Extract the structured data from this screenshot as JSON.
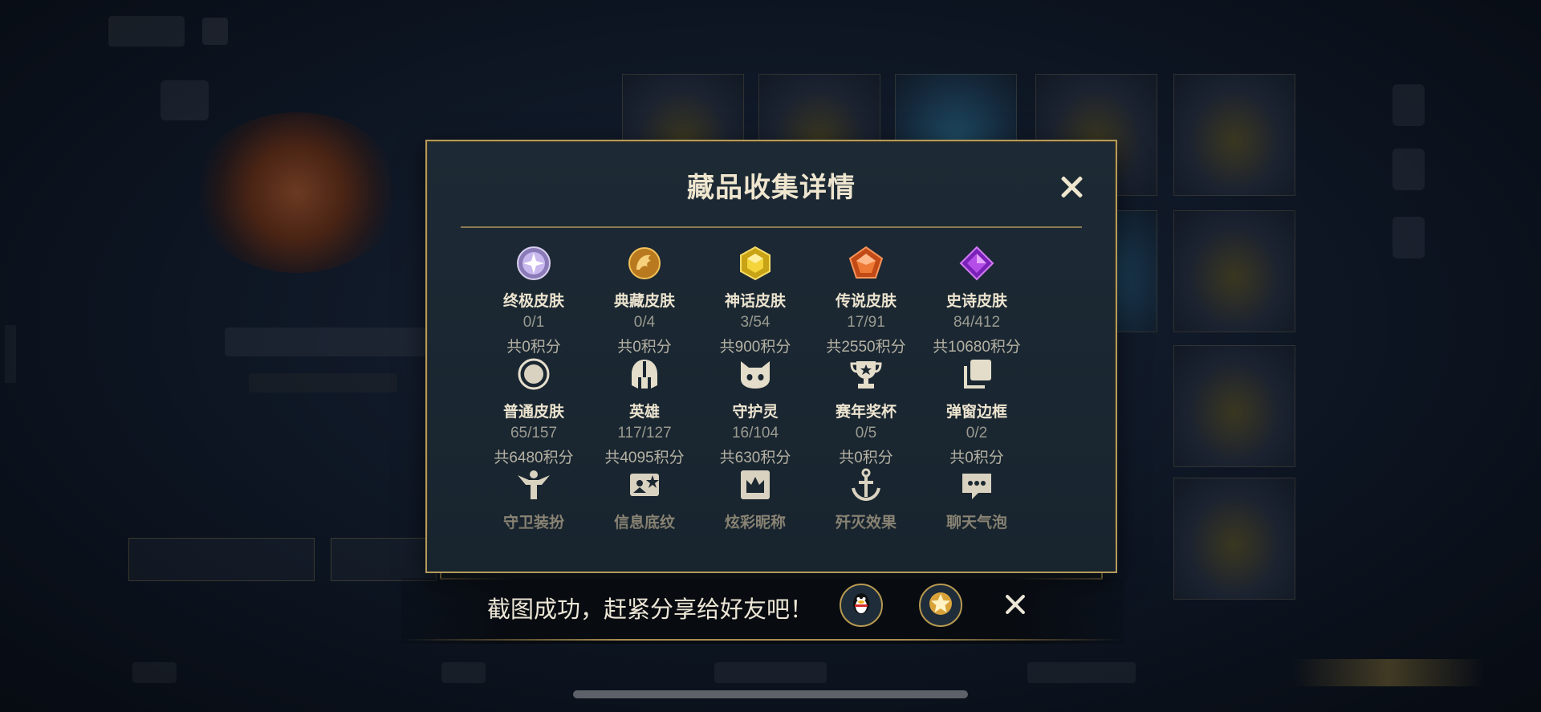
{
  "modal": {
    "title": "藏品收集详情",
    "rows": [
      [
        {
          "icon": "ultimate-skin-icon",
          "name": "终极皮肤",
          "count": "0/1",
          "score": "共0积分"
        },
        {
          "icon": "collection-skin-icon",
          "name": "典藏皮肤",
          "count": "0/4",
          "score": "共0积分"
        },
        {
          "icon": "myth-skin-icon",
          "name": "神话皮肤",
          "count": "3/54",
          "score": "共900积分"
        },
        {
          "icon": "legend-skin-icon",
          "name": "传说皮肤",
          "count": "17/91",
          "score": "共2550积分"
        },
        {
          "icon": "epic-skin-icon",
          "name": "史诗皮肤",
          "count": "84/412",
          "score": "共10680积分"
        }
      ],
      [
        {
          "icon": "normal-skin-icon",
          "name": "普通皮肤",
          "count": "65/157",
          "score": "共6480积分"
        },
        {
          "icon": "hero-helmet-icon",
          "name": "英雄",
          "count": "117/127",
          "score": "共4095积分"
        },
        {
          "icon": "guardian-spirit-icon",
          "name": "守护灵",
          "count": "16/104",
          "score": "共630积分"
        },
        {
          "icon": "season-trophy-icon",
          "name": "赛年奖杯",
          "count": "0/5",
          "score": "共0积分"
        },
        {
          "icon": "popup-frame-icon",
          "name": "弹窗边框",
          "count": "0/2",
          "score": "共0积分"
        }
      ],
      [
        {
          "icon": "guard-outfit-icon",
          "name": "守卫装扮"
        },
        {
          "icon": "info-pattern-icon",
          "name": "信息底纹"
        },
        {
          "icon": "colorful-nickname-icon",
          "name": "炫彩昵称"
        },
        {
          "icon": "annihilation-effect-icon",
          "name": "歼灭效果"
        },
        {
          "icon": "chat-bubble-icon",
          "name": "聊天气泡"
        }
      ]
    ]
  },
  "share": {
    "message": "截图成功，赶紧分享给好友吧！",
    "buttons": [
      {
        "icon": "qq-penguin-icon"
      },
      {
        "icon": "star-badge-icon"
      }
    ]
  },
  "colors": {
    "gold_border": "#b49a5c",
    "modal_bg": "#1b2731",
    "title_text": "#efe6cf"
  }
}
